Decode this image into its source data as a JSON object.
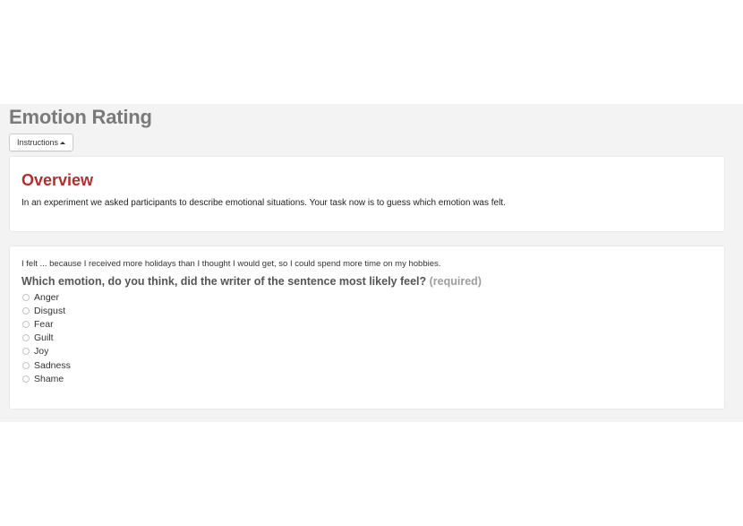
{
  "page": {
    "title": "Emotion Rating"
  },
  "instructions_button": {
    "label": "Instructions"
  },
  "overview": {
    "heading": "Overview",
    "text": "In an experiment we asked participants to describe emotional situations. Your task now is to guess which emotion was felt."
  },
  "question": {
    "prompt": "I felt ... because I received more holidays than I thought I would get, so I could spend more time on my hobbies.",
    "text": "Which emotion, do you think, did the writer of the sentence most likely feel?",
    "required_label": "(required)",
    "options": [
      "Anger",
      "Disgust",
      "Fear",
      "Guilt",
      "Joy",
      "Sadness",
      "Shame"
    ]
  },
  "colors": {
    "heading_red": "#b03030",
    "title_gray": "#7a7a7a",
    "background": "#f3f3f3"
  },
  "icons": {
    "instructions_caret": "caret-up-icon",
    "option_control": "radio-button"
  }
}
